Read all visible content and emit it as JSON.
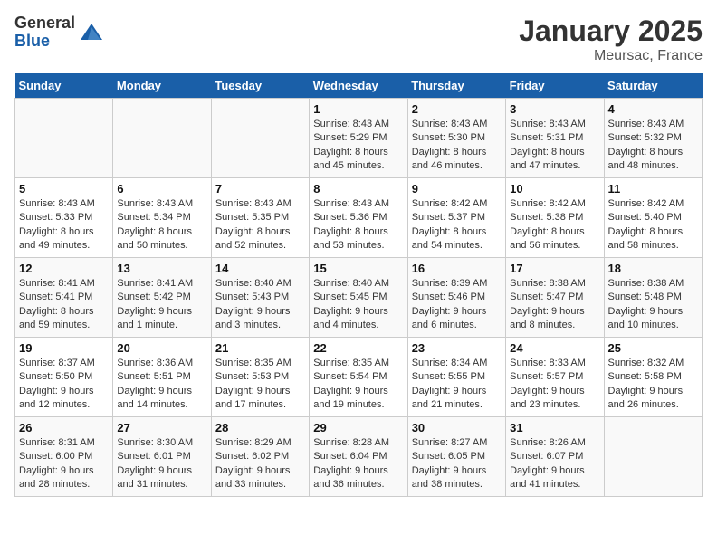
{
  "header": {
    "logo_general": "General",
    "logo_blue": "Blue",
    "title": "January 2025",
    "subtitle": "Meursac, France"
  },
  "days_of_week": [
    "Sunday",
    "Monday",
    "Tuesday",
    "Wednesday",
    "Thursday",
    "Friday",
    "Saturday"
  ],
  "weeks": [
    [
      {
        "day": "",
        "info": ""
      },
      {
        "day": "",
        "info": ""
      },
      {
        "day": "",
        "info": ""
      },
      {
        "day": "1",
        "info": "Sunrise: 8:43 AM\nSunset: 5:29 PM\nDaylight: 8 hours\nand 45 minutes."
      },
      {
        "day": "2",
        "info": "Sunrise: 8:43 AM\nSunset: 5:30 PM\nDaylight: 8 hours\nand 46 minutes."
      },
      {
        "day": "3",
        "info": "Sunrise: 8:43 AM\nSunset: 5:31 PM\nDaylight: 8 hours\nand 47 minutes."
      },
      {
        "day": "4",
        "info": "Sunrise: 8:43 AM\nSunset: 5:32 PM\nDaylight: 8 hours\nand 48 minutes."
      }
    ],
    [
      {
        "day": "5",
        "info": "Sunrise: 8:43 AM\nSunset: 5:33 PM\nDaylight: 8 hours\nand 49 minutes."
      },
      {
        "day": "6",
        "info": "Sunrise: 8:43 AM\nSunset: 5:34 PM\nDaylight: 8 hours\nand 50 minutes."
      },
      {
        "day": "7",
        "info": "Sunrise: 8:43 AM\nSunset: 5:35 PM\nDaylight: 8 hours\nand 52 minutes."
      },
      {
        "day": "8",
        "info": "Sunrise: 8:43 AM\nSunset: 5:36 PM\nDaylight: 8 hours\nand 53 minutes."
      },
      {
        "day": "9",
        "info": "Sunrise: 8:42 AM\nSunset: 5:37 PM\nDaylight: 8 hours\nand 54 minutes."
      },
      {
        "day": "10",
        "info": "Sunrise: 8:42 AM\nSunset: 5:38 PM\nDaylight: 8 hours\nand 56 minutes."
      },
      {
        "day": "11",
        "info": "Sunrise: 8:42 AM\nSunset: 5:40 PM\nDaylight: 8 hours\nand 58 minutes."
      }
    ],
    [
      {
        "day": "12",
        "info": "Sunrise: 8:41 AM\nSunset: 5:41 PM\nDaylight: 8 hours\nand 59 minutes."
      },
      {
        "day": "13",
        "info": "Sunrise: 8:41 AM\nSunset: 5:42 PM\nDaylight: 9 hours\nand 1 minute."
      },
      {
        "day": "14",
        "info": "Sunrise: 8:40 AM\nSunset: 5:43 PM\nDaylight: 9 hours\nand 3 minutes."
      },
      {
        "day": "15",
        "info": "Sunrise: 8:40 AM\nSunset: 5:45 PM\nDaylight: 9 hours\nand 4 minutes."
      },
      {
        "day": "16",
        "info": "Sunrise: 8:39 AM\nSunset: 5:46 PM\nDaylight: 9 hours\nand 6 minutes."
      },
      {
        "day": "17",
        "info": "Sunrise: 8:38 AM\nSunset: 5:47 PM\nDaylight: 9 hours\nand 8 minutes."
      },
      {
        "day": "18",
        "info": "Sunrise: 8:38 AM\nSunset: 5:48 PM\nDaylight: 9 hours\nand 10 minutes."
      }
    ],
    [
      {
        "day": "19",
        "info": "Sunrise: 8:37 AM\nSunset: 5:50 PM\nDaylight: 9 hours\nand 12 minutes."
      },
      {
        "day": "20",
        "info": "Sunrise: 8:36 AM\nSunset: 5:51 PM\nDaylight: 9 hours\nand 14 minutes."
      },
      {
        "day": "21",
        "info": "Sunrise: 8:35 AM\nSunset: 5:53 PM\nDaylight: 9 hours\nand 17 minutes."
      },
      {
        "day": "22",
        "info": "Sunrise: 8:35 AM\nSunset: 5:54 PM\nDaylight: 9 hours\nand 19 minutes."
      },
      {
        "day": "23",
        "info": "Sunrise: 8:34 AM\nSunset: 5:55 PM\nDaylight: 9 hours\nand 21 minutes."
      },
      {
        "day": "24",
        "info": "Sunrise: 8:33 AM\nSunset: 5:57 PM\nDaylight: 9 hours\nand 23 minutes."
      },
      {
        "day": "25",
        "info": "Sunrise: 8:32 AM\nSunset: 5:58 PM\nDaylight: 9 hours\nand 26 minutes."
      }
    ],
    [
      {
        "day": "26",
        "info": "Sunrise: 8:31 AM\nSunset: 6:00 PM\nDaylight: 9 hours\nand 28 minutes."
      },
      {
        "day": "27",
        "info": "Sunrise: 8:30 AM\nSunset: 6:01 PM\nDaylight: 9 hours\nand 31 minutes."
      },
      {
        "day": "28",
        "info": "Sunrise: 8:29 AM\nSunset: 6:02 PM\nDaylight: 9 hours\nand 33 minutes."
      },
      {
        "day": "29",
        "info": "Sunrise: 8:28 AM\nSunset: 6:04 PM\nDaylight: 9 hours\nand 36 minutes."
      },
      {
        "day": "30",
        "info": "Sunrise: 8:27 AM\nSunset: 6:05 PM\nDaylight: 9 hours\nand 38 minutes."
      },
      {
        "day": "31",
        "info": "Sunrise: 8:26 AM\nSunset: 6:07 PM\nDaylight: 9 hours\nand 41 minutes."
      },
      {
        "day": "",
        "info": ""
      }
    ]
  ]
}
